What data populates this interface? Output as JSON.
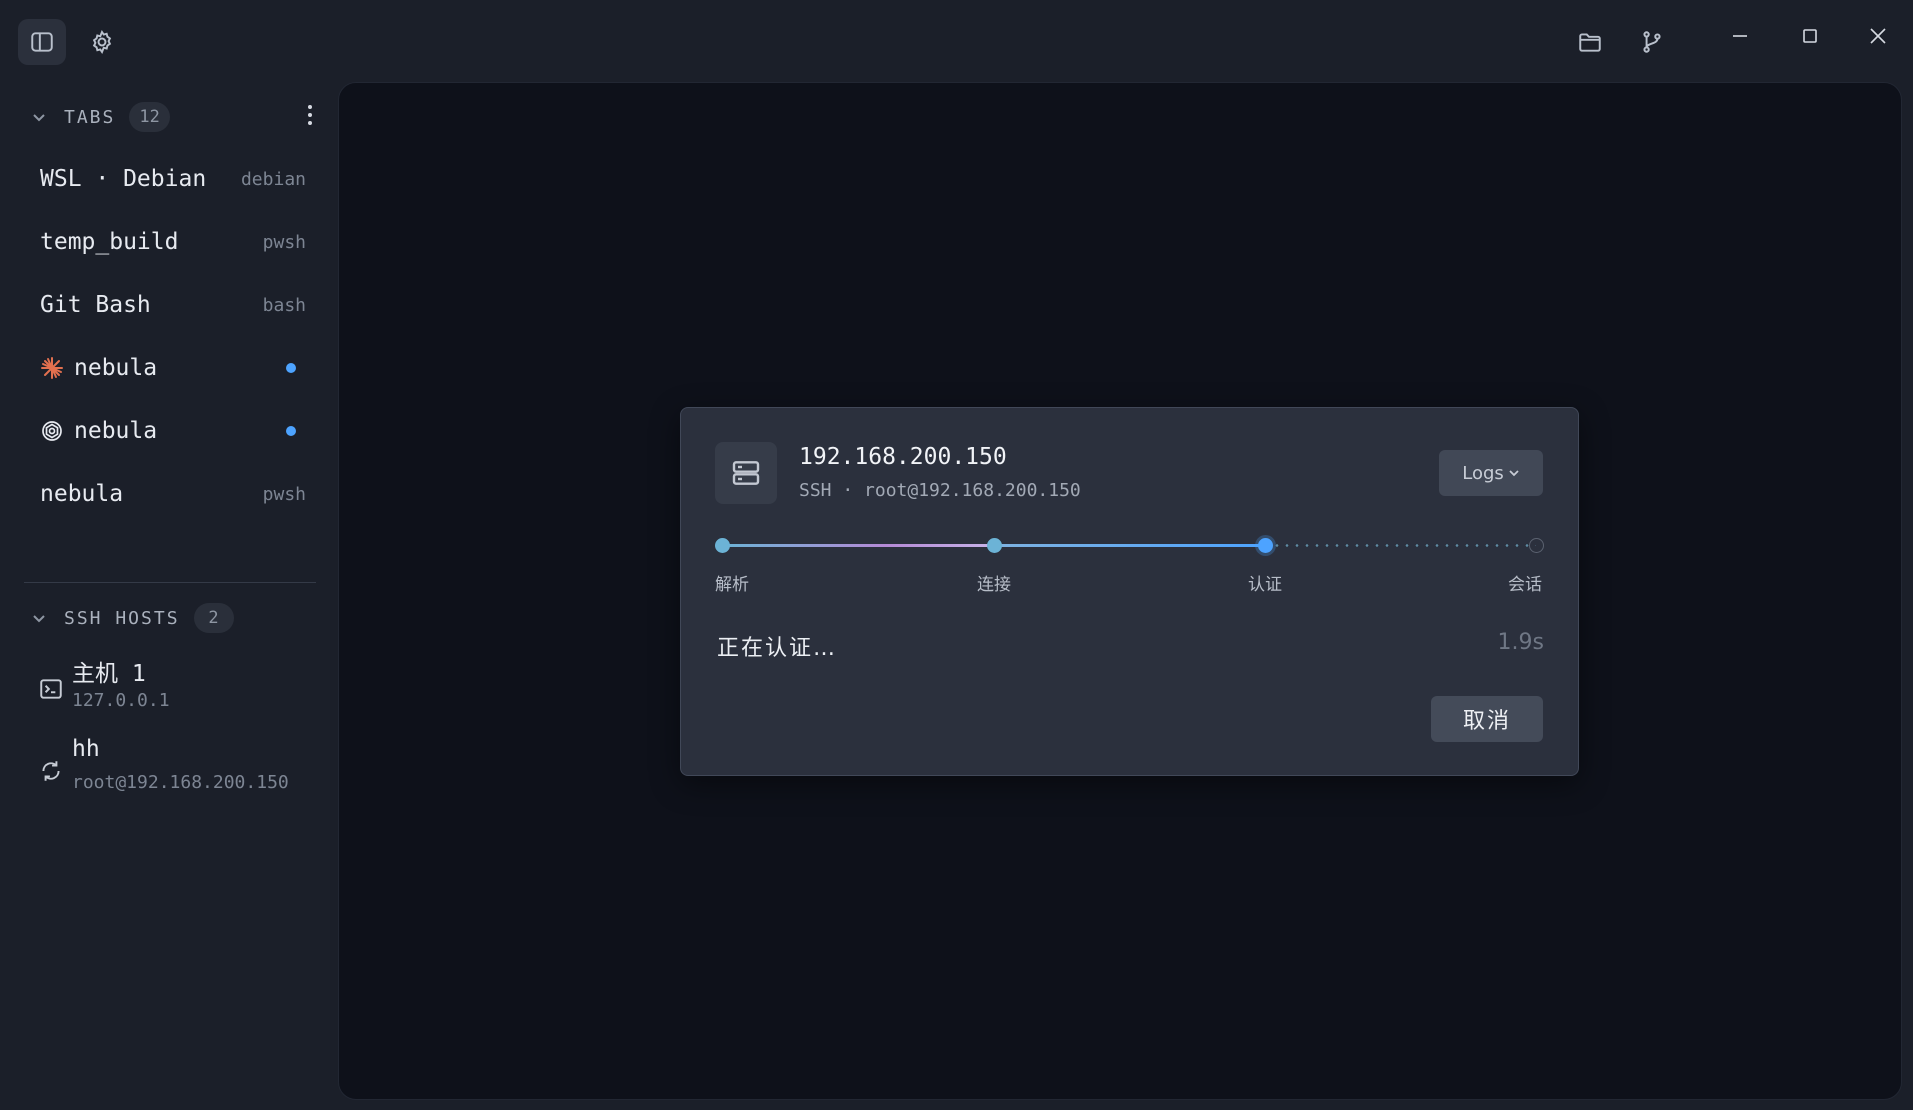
{
  "sidebar": {
    "tabs_section": {
      "title": "TABS",
      "count": "12"
    },
    "tabs": [
      {
        "label": "WSL · Debian",
        "meta": "debian",
        "icon": "none"
      },
      {
        "label": "temp_build",
        "meta": "pwsh",
        "icon": "none"
      },
      {
        "label": "Git Bash",
        "meta": "bash",
        "icon": "none"
      },
      {
        "label": "nebula",
        "meta": "",
        "icon": "claude-icon",
        "dot_color": "#4da3ff"
      },
      {
        "label": "nebula",
        "meta": "",
        "icon": "openai-icon",
        "dot_color": "#4da3ff"
      },
      {
        "label": "nebula",
        "meta": "pwsh",
        "icon": "none"
      }
    ],
    "hosts_section": {
      "title": "SSH HOSTS",
      "count": "2"
    },
    "hosts": [
      {
        "name": "主机 1",
        "address": "127.0.0.1",
        "icon": "terminal-icon"
      },
      {
        "name": "hh",
        "address": "root@192.168.200.150",
        "icon": "sync-icon"
      }
    ]
  },
  "dialog": {
    "host": "192.168.200.150",
    "subtitle": "SSH · root@192.168.200.150",
    "logs_label": "Logs",
    "steps": [
      {
        "label": "解析",
        "state": "done"
      },
      {
        "label": "连接",
        "state": "done"
      },
      {
        "label": "认证",
        "state": "current"
      },
      {
        "label": "会话",
        "state": "pending"
      }
    ],
    "status": "正在认证…",
    "elapsed": "1.9s",
    "cancel_label": "取消"
  },
  "colors": {
    "accent": "#4da3ff",
    "step_done": "#6cb3d6",
    "background": "#0e111a",
    "sidebar": "#1b1f29",
    "dialog": "#2b303d"
  }
}
